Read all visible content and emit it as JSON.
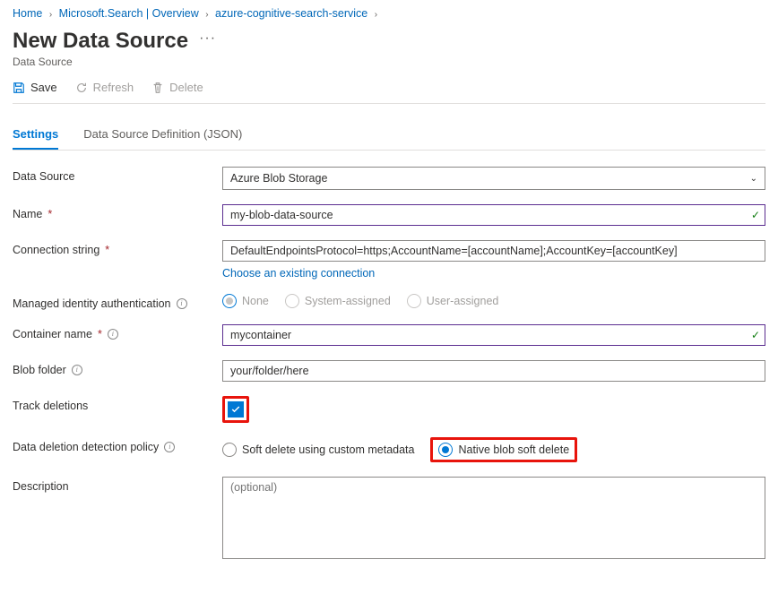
{
  "breadcrumb": {
    "home": "Home",
    "level1": "Microsoft.Search | Overview",
    "level2": "azure-cognitive-search-service"
  },
  "page": {
    "title": "New Data Source",
    "subtitle": "Data Source"
  },
  "commands": {
    "save": "Save",
    "refresh": "Refresh",
    "delete": "Delete"
  },
  "tabs": {
    "settings": "Settings",
    "json": "Data Source Definition (JSON)"
  },
  "labels": {
    "dataSource": "Data Source",
    "name": "Name",
    "connectionString": "Connection string",
    "managedIdentity": "Managed identity authentication",
    "containerName": "Container name",
    "blobFolder": "Blob folder",
    "trackDeletions": "Track deletions",
    "deletionPolicy": "Data deletion detection policy",
    "description": "Description"
  },
  "fields": {
    "dataSource": "Azure Blob Storage",
    "name": "my-blob-data-source",
    "connectionString": "DefaultEndpointsProtocol=https;AccountName=[accountName];AccountKey=[accountKey]",
    "chooseExisting": "Choose an existing connection",
    "managedIdentity": {
      "none": "None",
      "system": "System-assigned",
      "user": "User-assigned"
    },
    "containerName": "mycontainer",
    "blobFolder": "your/folder/here",
    "deletionPolicy": {
      "softDeleteCustom": "Soft delete using custom metadata",
      "nativeSoftDelete": "Native blob soft delete"
    },
    "descriptionPlaceholder": "(optional)"
  }
}
